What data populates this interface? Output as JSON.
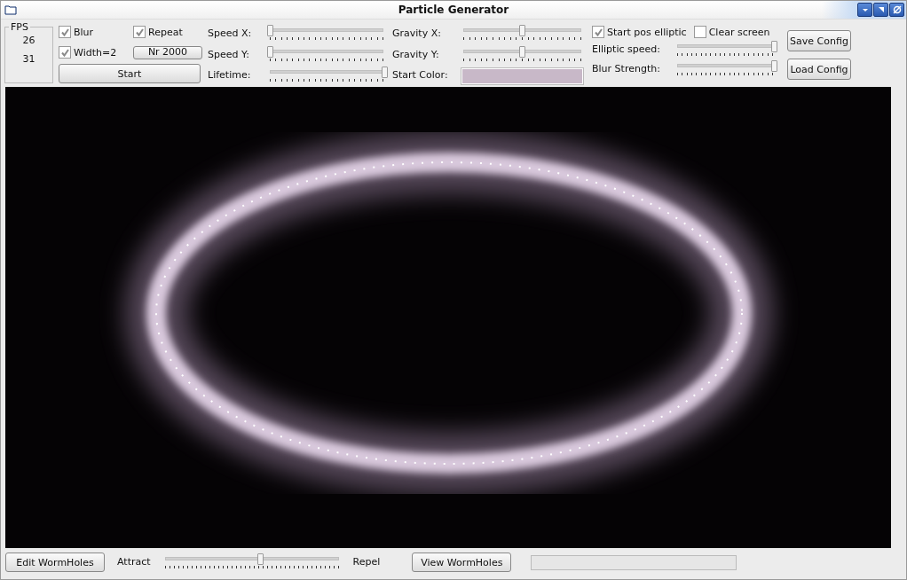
{
  "window": {
    "title": "Particle Generator"
  },
  "fps": {
    "label": "FPS",
    "values": [
      "26",
      "31"
    ]
  },
  "checkboxes": [
    {
      "label": "Blur",
      "checked": true
    },
    {
      "label": "Repeat",
      "checked": true
    },
    {
      "label": "Width=2",
      "checked": true
    }
  ],
  "count_button": "Nr 2000",
  "start_button": "Start",
  "sliders_left": [
    {
      "label": "Speed X:",
      "level": 0.02
    },
    {
      "label": "Speed Y:",
      "level": 0.02
    },
    {
      "label": "Lifetime:",
      "level": 1.0
    }
  ],
  "sliders_mid": [
    {
      "label": "Gravity X:",
      "level": 0.5
    },
    {
      "label": "Gravity Y:",
      "level": 0.5
    }
  ],
  "start_color": {
    "label": "Start Color:",
    "color": "#c8b8c8"
  },
  "options": [
    {
      "label": "Start pos elliptic",
      "checked": true
    },
    {
      "label": "Clear screen",
      "checked": false
    }
  ],
  "sliders_right": [
    {
      "label": "Elliptic speed:",
      "level": 1.0
    },
    {
      "label": "Blur Strength:",
      "level": 1.0
    }
  ],
  "config_buttons": [
    "Save Config",
    "Load Config"
  ],
  "bottom": {
    "edit_button": "Edit WormHoles",
    "left_label": "Attract",
    "slider": {
      "level": 0.55
    },
    "right_label": "Repel",
    "view_button": "View WormHoles",
    "progress": {
      "level": 0
    }
  }
}
